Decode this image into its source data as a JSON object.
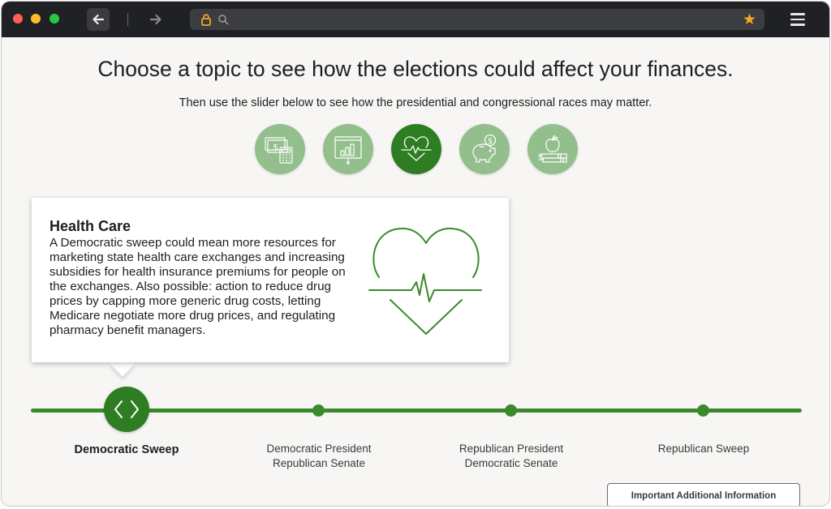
{
  "browser": {
    "url": "",
    "back_icon": "arrow-left-icon",
    "forward_icon": "arrow-right-icon",
    "bookmark_icon": "star-icon",
    "menu_icon": "hamburger-menu-icon"
  },
  "page": {
    "headline": "Choose a topic to see how the elections could affect your finances.",
    "subline": "Then use the slider below to see how the presidential and congressional races may matter."
  },
  "topics": [
    {
      "icon": "money-calculator-icon",
      "active": false
    },
    {
      "icon": "presentation-chart-icon",
      "active": false
    },
    {
      "icon": "heart-pulse-icon",
      "active": true
    },
    {
      "icon": "piggy-bank-icon",
      "active": false
    },
    {
      "icon": "apple-books-icon",
      "active": false
    }
  ],
  "card": {
    "title": "Health Care",
    "body": "A Democratic sweep could mean more resources for marketing state health care exchanges and increasing subsidies for health insurance premiums for people on the exchanges. Also possible: action to reduce drug prices by capping more generic drug costs, letting Medicare negotiate more drug prices, and regulating pharmacy benefit managers."
  },
  "slider": {
    "selected_index": 0,
    "stops": [
      {
        "label": "Democratic Sweep"
      },
      {
        "label": "Democratic President Republican Senate"
      },
      {
        "label": "Republican President Democratic Senate"
      },
      {
        "label": "Republican Sweep"
      }
    ]
  },
  "footer": {
    "info_button": "Important Additional Information"
  },
  "colors": {
    "accent": "#2e7d22",
    "accent_light": "#93bf8c",
    "track": "#3a8a2c"
  }
}
